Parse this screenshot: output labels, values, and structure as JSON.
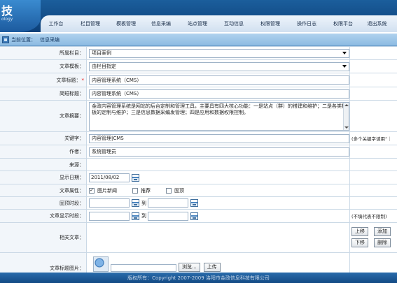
{
  "header": {
    "logo_text": "技",
    "logo_subtext": "ology",
    "nav": [
      "工作台",
      "栏目管理",
      "模板管理",
      "信息采编",
      "站点管理",
      "互动信息",
      "权限管理",
      "操作日志",
      "权限平台",
      "退出系统"
    ]
  },
  "location": {
    "label": "当前位置：",
    "value": "信息采编"
  },
  "form": {
    "column": {
      "label": "所属栏目：",
      "value": "项目案例"
    },
    "template": {
      "label": "文章模板：",
      "value": "由栏目指定"
    },
    "title": {
      "label": "文章标题：",
      "required_mark": "*",
      "value": "内容管理系统（CMS）"
    },
    "short_title": {
      "label": "简短标题：",
      "value": "内容管理系统（CMS）"
    },
    "summary": {
      "label": "文章摘要：",
      "value": "金政内容管理系统是网站的后台定制和管理工具，主要具有四大核心功能：一是站点（群）的搭建和维护；二是各类模板的定制与维护；三是信息数据采编发管理；四是应用和数据权限控制。"
    },
    "keywords": {
      "label": "关键字：",
      "value": "内容管理|CMS",
      "hint": "(多个关键字请用“｜"
    },
    "author": {
      "label": "作者：",
      "value": "系统管理员"
    },
    "source": {
      "label": "来源：",
      "value": ""
    },
    "display_date": {
      "label": "显示日期：",
      "value": "2011/08/02"
    },
    "attributes": {
      "label": "文章属性：",
      "options": [
        {
          "label": "图片新闻",
          "checked": true
        },
        {
          "label": "推荐",
          "checked": false
        },
        {
          "label": "固顶",
          "checked": false
        }
      ]
    },
    "top_period": {
      "label": "固顶时段：",
      "to": "到"
    },
    "show_period": {
      "label": "文章显示时段：",
      "to": "到",
      "hint": "(不填代表不限制)"
    },
    "related": {
      "label": "相关文章：",
      "buttons": {
        "up": "上移",
        "add": "添加",
        "down": "下移",
        "delete": "删除"
      }
    },
    "title_image": {
      "label": "文章标题图片：",
      "browse": "浏览...",
      "upload": "上传"
    }
  },
  "footer": {
    "text": "版权所有：Copyright 2007-2009 洛阳市金政信息科技有限公司"
  }
}
